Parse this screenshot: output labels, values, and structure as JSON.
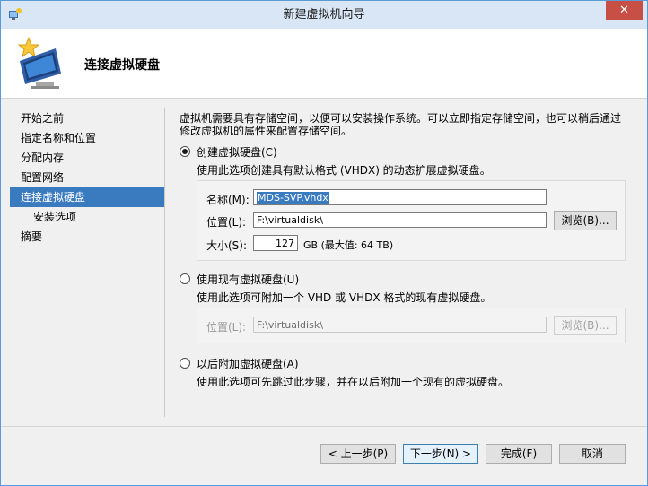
{
  "window": {
    "title": "新建虚拟机向导",
    "close_label": "✕"
  },
  "header": {
    "title": "连接虚拟硬盘"
  },
  "sidebar": {
    "items": [
      {
        "label": "开始之前"
      },
      {
        "label": "指定名称和位置"
      },
      {
        "label": "分配内存"
      },
      {
        "label": "配置网络"
      },
      {
        "label": "连接虚拟硬盘"
      },
      {
        "label": "安装选项"
      },
      {
        "label": "摘要"
      }
    ],
    "active_index": 4
  },
  "intro": {
    "text": "虚拟机需要具有存储空间，以便可以安装操作系统。可以立即指定存储空间，也可以稍后通过修改虚拟机的属性来配置存储空间。"
  },
  "option_create": {
    "label": "创建虚拟硬盘(C)",
    "description": "使用此选项创建具有默认格式 (VHDX) 的动态扩展虚拟硬盘。",
    "selected": true,
    "name_label": "名称(M):",
    "name_value": "MDS-SVP.vhdx",
    "location_label": "位置(L):",
    "location_value": "F:\\virtualdisk\\",
    "browse_label": "浏览(B)...",
    "size_label": "大小(S):",
    "size_value": "127",
    "size_unit": "GB (最大值: 64 TB)"
  },
  "option_existing": {
    "label": "使用现有虚拟硬盘(U)",
    "description": "使用此选项可附加一个 VHD 或 VHDX 格式的现有虚拟硬盘。",
    "selected": false,
    "location_label": "位置(L):",
    "location_value": "F:\\virtualdisk\\",
    "browse_label": "浏览(B)..."
  },
  "option_later": {
    "label": "以后附加虚拟硬盘(A)",
    "description": "使用此选项可先跳过此步骤，并在以后附加一个现有的虚拟硬盘。",
    "selected": false
  },
  "buttons": {
    "previous": "< 上一步(P)",
    "next": "下一步(N) >",
    "finish": "完成(F)",
    "cancel": "取消"
  },
  "colors": {
    "accent": "#3a7bbf",
    "close": "#c74f45",
    "titlebar": "#d9e6f5"
  }
}
